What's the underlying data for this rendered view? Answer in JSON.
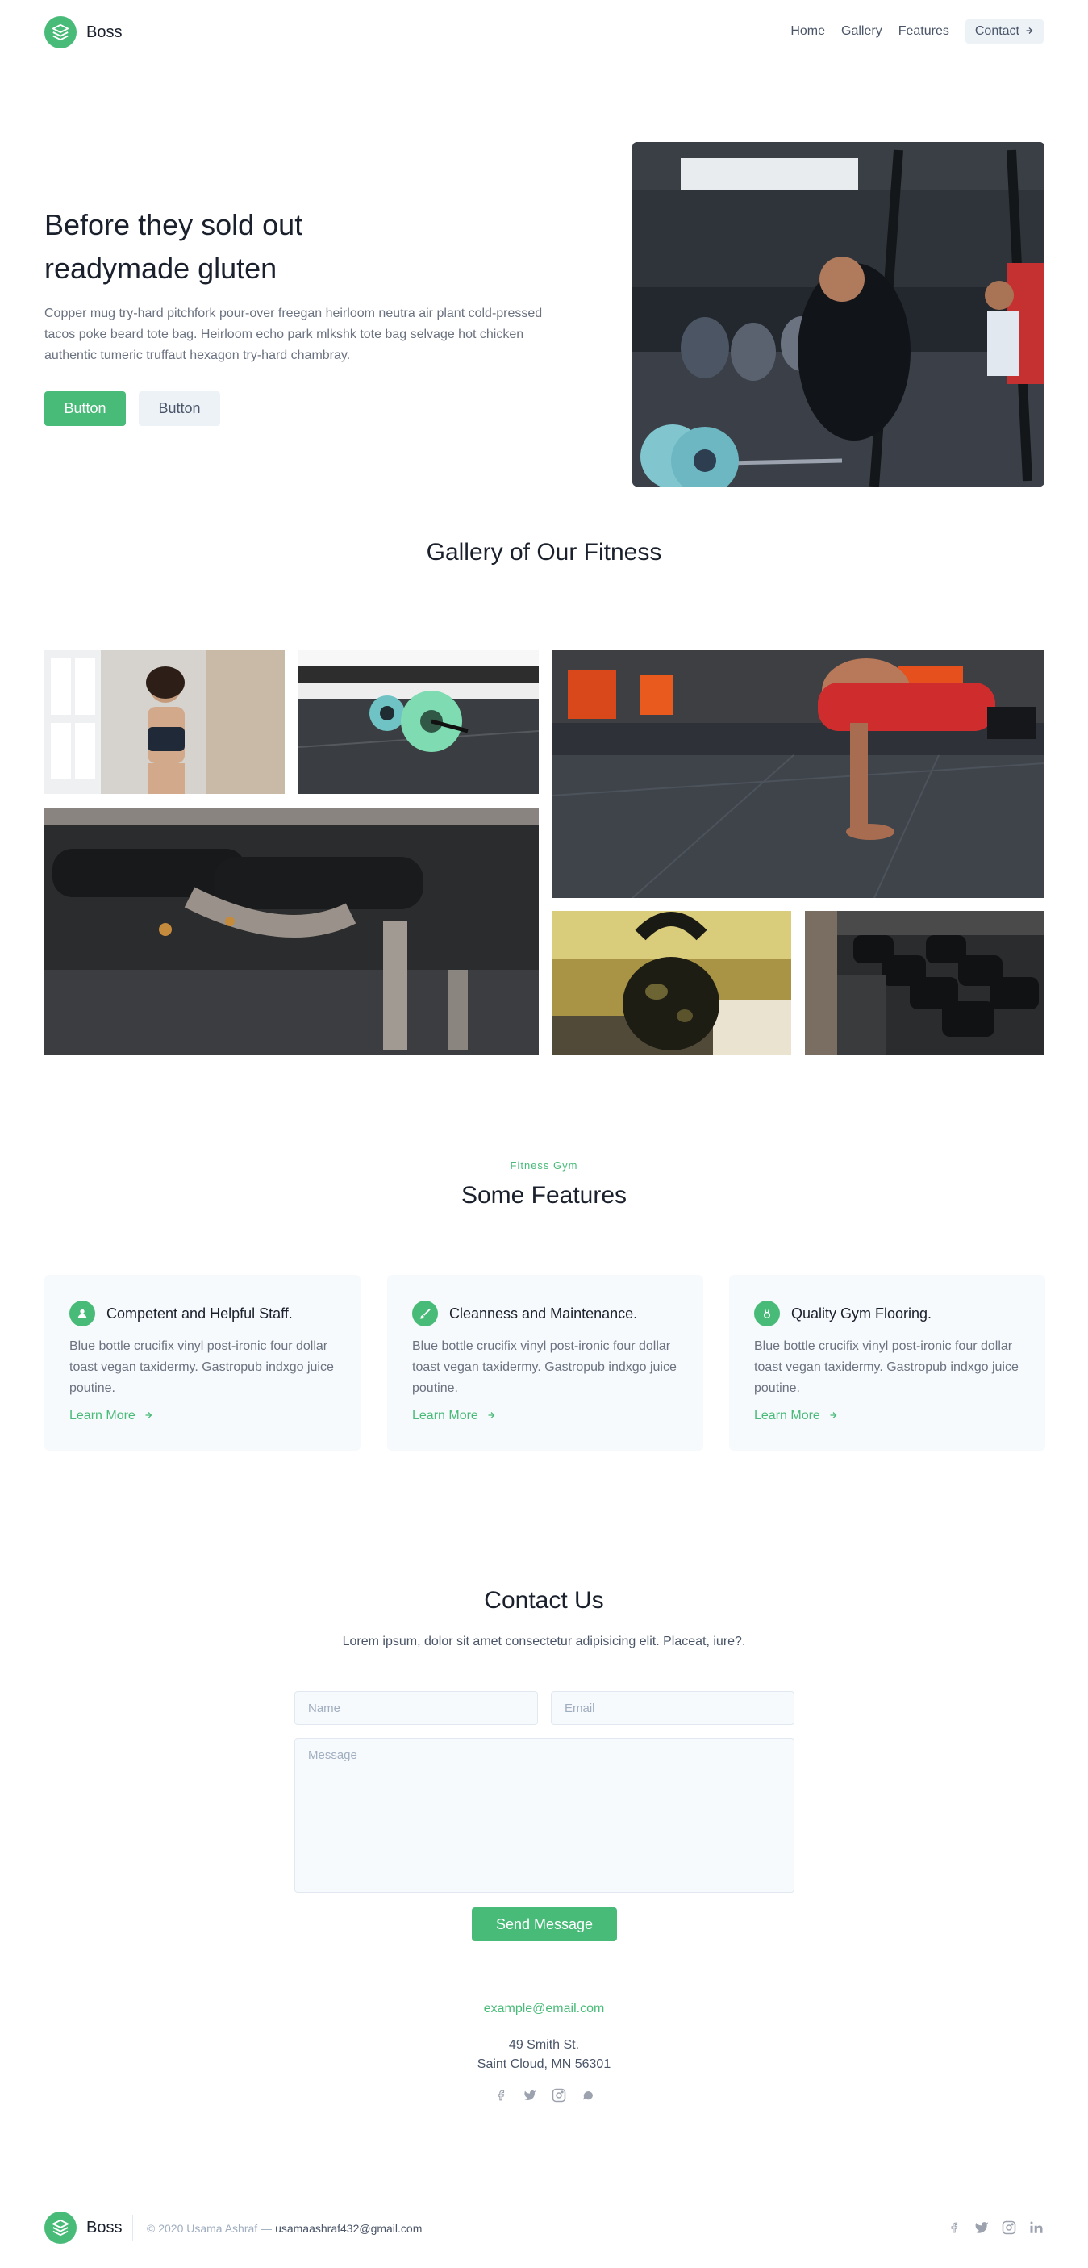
{
  "header": {
    "brand": "Boss",
    "nav": [
      "Home",
      "Gallery",
      "Features"
    ],
    "contact_button": "Contact"
  },
  "hero": {
    "title_line1": "Before they sold out",
    "title_line2": "readymade gluten",
    "text": "Copper mug try-hard pitchfork pour-over freegan heirloom neutra air plant cold-pressed tacos poke beard tote bag. Heirloom echo park mlkshk tote bag selvage hot chicken authentic tumeric truffaut hexagon try-hard chambray.",
    "primary_button": "Button",
    "secondary_button": "Button"
  },
  "gallery": {
    "title": "Gallery of Our Fitness"
  },
  "features": {
    "eyebrow": "Fitness Gym",
    "title": "Some Features",
    "cards": [
      {
        "title": "Competent and Helpful Staff.",
        "text": "Blue bottle crucifix vinyl post-ironic four dollar toast vegan taxidermy. Gastropub indxgo juice poutine.",
        "link": "Learn More",
        "icon": "user-icon"
      },
      {
        "title": "Cleanness and Maintenance.",
        "text": "Blue bottle crucifix vinyl post-ironic four dollar toast vegan taxidermy. Gastropub indxgo juice poutine.",
        "link": "Learn More",
        "icon": "brush-icon"
      },
      {
        "title": "Quality Gym Flooring.",
        "text": "Blue bottle crucifix vinyl post-ironic four dollar toast vegan taxidermy. Gastropub indxgo juice poutine.",
        "link": "Learn More",
        "icon": "medal-icon"
      }
    ]
  },
  "contact": {
    "title": "Contact Us",
    "subtitle": "Lorem ipsum, dolor sit amet consectetur adipisicing elit. Placeat, iure?.",
    "name_placeholder": "Name",
    "email_placeholder": "Email",
    "message_placeholder": "Message",
    "send_button": "Send Message",
    "email": "example@email.com",
    "address_line1": "49 Smith St.",
    "address_line2": "Saint Cloud, MN 56301"
  },
  "footer": {
    "brand": "Boss",
    "copyright": "© 2020 Usama Ashraf —",
    "email": "usamaashraf432@gmail.com"
  },
  "colors": {
    "accent": "#48bb78",
    "heading": "#1a202c",
    "body_text": "#6b7280",
    "card_bg": "#f7fafc"
  }
}
